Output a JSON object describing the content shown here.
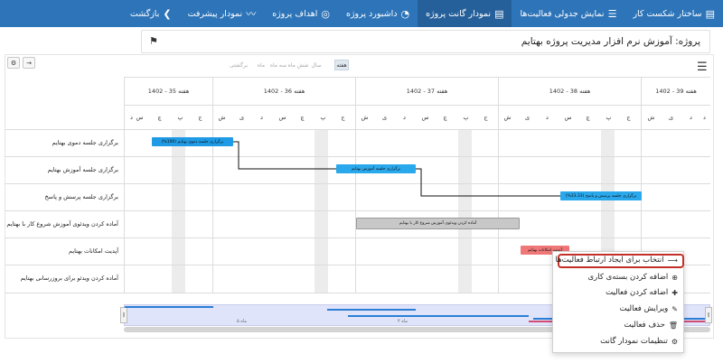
{
  "nav": {
    "items": [
      {
        "label": "ساختار شکست کار",
        "icon": "wbs-icon",
        "glyph": "▤"
      },
      {
        "label": "نمایش جدولی فعالیت‌ها",
        "icon": "table-icon",
        "glyph": "☰"
      },
      {
        "label": "نمودار گانت پروژه",
        "icon": "gantt-icon",
        "glyph": "▤"
      },
      {
        "label": "داشبورد پروژه",
        "icon": "pie-chart-icon",
        "glyph": "◔"
      },
      {
        "label": "اهداف پروژه",
        "icon": "target-icon",
        "glyph": "◎"
      },
      {
        "label": "نمودار پیشرفت",
        "icon": "line-chart-icon",
        "glyph": "〰"
      },
      {
        "label": "بازگشت",
        "icon": "back-arrow-icon",
        "glyph": "❯"
      }
    ],
    "active_index": 2,
    "active_color": "#26609b",
    "bar_color": "#2d74b8"
  },
  "project": {
    "title": "پروژه: آموزش نرم افزار مدیریت پروژه بهتایم",
    "bell_icon": "bell-icon"
  },
  "toolbar": {
    "zoom_options": [
      "برگشتی",
      "ماه",
      "سه ماه",
      "شش ماه",
      "سال",
      "هفته"
    ],
    "active_zoom": "هفته",
    "menu_icon": "hamburger-icon"
  },
  "timeline": {
    "weeks": [
      "هفته 39 - 1402",
      "هفته 38 - 1402",
      "هفته 37 - 1402",
      "هفته 36 - 1402",
      "هفته 35 - 1402"
    ],
    "days": [
      "ش",
      "ی",
      "د",
      "س",
      "چ",
      "پ",
      "ج"
    ]
  },
  "tasks": [
    {
      "name": "برگزاری جلسه دموی بهتایم",
      "bar_label": "برگزاری جلسه دموی بهتایم (100%)",
      "color": "#1f9be6"
    },
    {
      "name": "برگزاری جلسه آموزش بهتایم",
      "bar_label": "برگزاری جلسه آموزش بهتایم",
      "color": "#2aa8ec"
    },
    {
      "name": "برگزاری جلسه پرسش و پاسخ",
      "bar_label": "برگزاری جلسه پرسش و پاسخ (33.33%)",
      "color": "#2aa8ec"
    },
    {
      "name": "آماده کردن ویدئوی آموزش شروع کار با بهتایم",
      "bar_label": "آماده کردن ویدئوی آموزش شروع کار با بهتایم",
      "color": "#c8c8c8"
    },
    {
      "name": "آپدیت امکانات بهتایم",
      "bar_label": "آپدیت امکانات بهتایم",
      "color": "#ef7777"
    },
    {
      "name": "آماده کردن ویدئو برای بروزرسانی بهتایم",
      "bar_label": "",
      "color": ""
    }
  ],
  "scrollzone": {
    "left_label": "ماه ۵",
    "right_label": "ماه ۴",
    "zone_color": "#e0e4fb"
  },
  "context_menu": {
    "items": [
      {
        "label": "انتخاب برای ایجاد ارتباط فعالیت‌ها",
        "icon": "link-arrow-icon",
        "glyph": "⟶"
      },
      {
        "label": "اضافه کردن بسته‌ی کاری",
        "icon": "add-circle-icon",
        "glyph": "⊕"
      },
      {
        "label": "اضافه کردن فعالیت",
        "icon": "plus-icon",
        "glyph": "✚"
      },
      {
        "label": "ویرایش فعالیت",
        "icon": "edit-icon",
        "glyph": "✎"
      },
      {
        "label": "حذف فعالیت",
        "icon": "trash-icon",
        "glyph": "🗑"
      },
      {
        "label": "تنظیمات نمودار گانت",
        "icon": "gear-icon",
        "glyph": "⚙"
      }
    ],
    "highlight_color": "#c3302a"
  }
}
